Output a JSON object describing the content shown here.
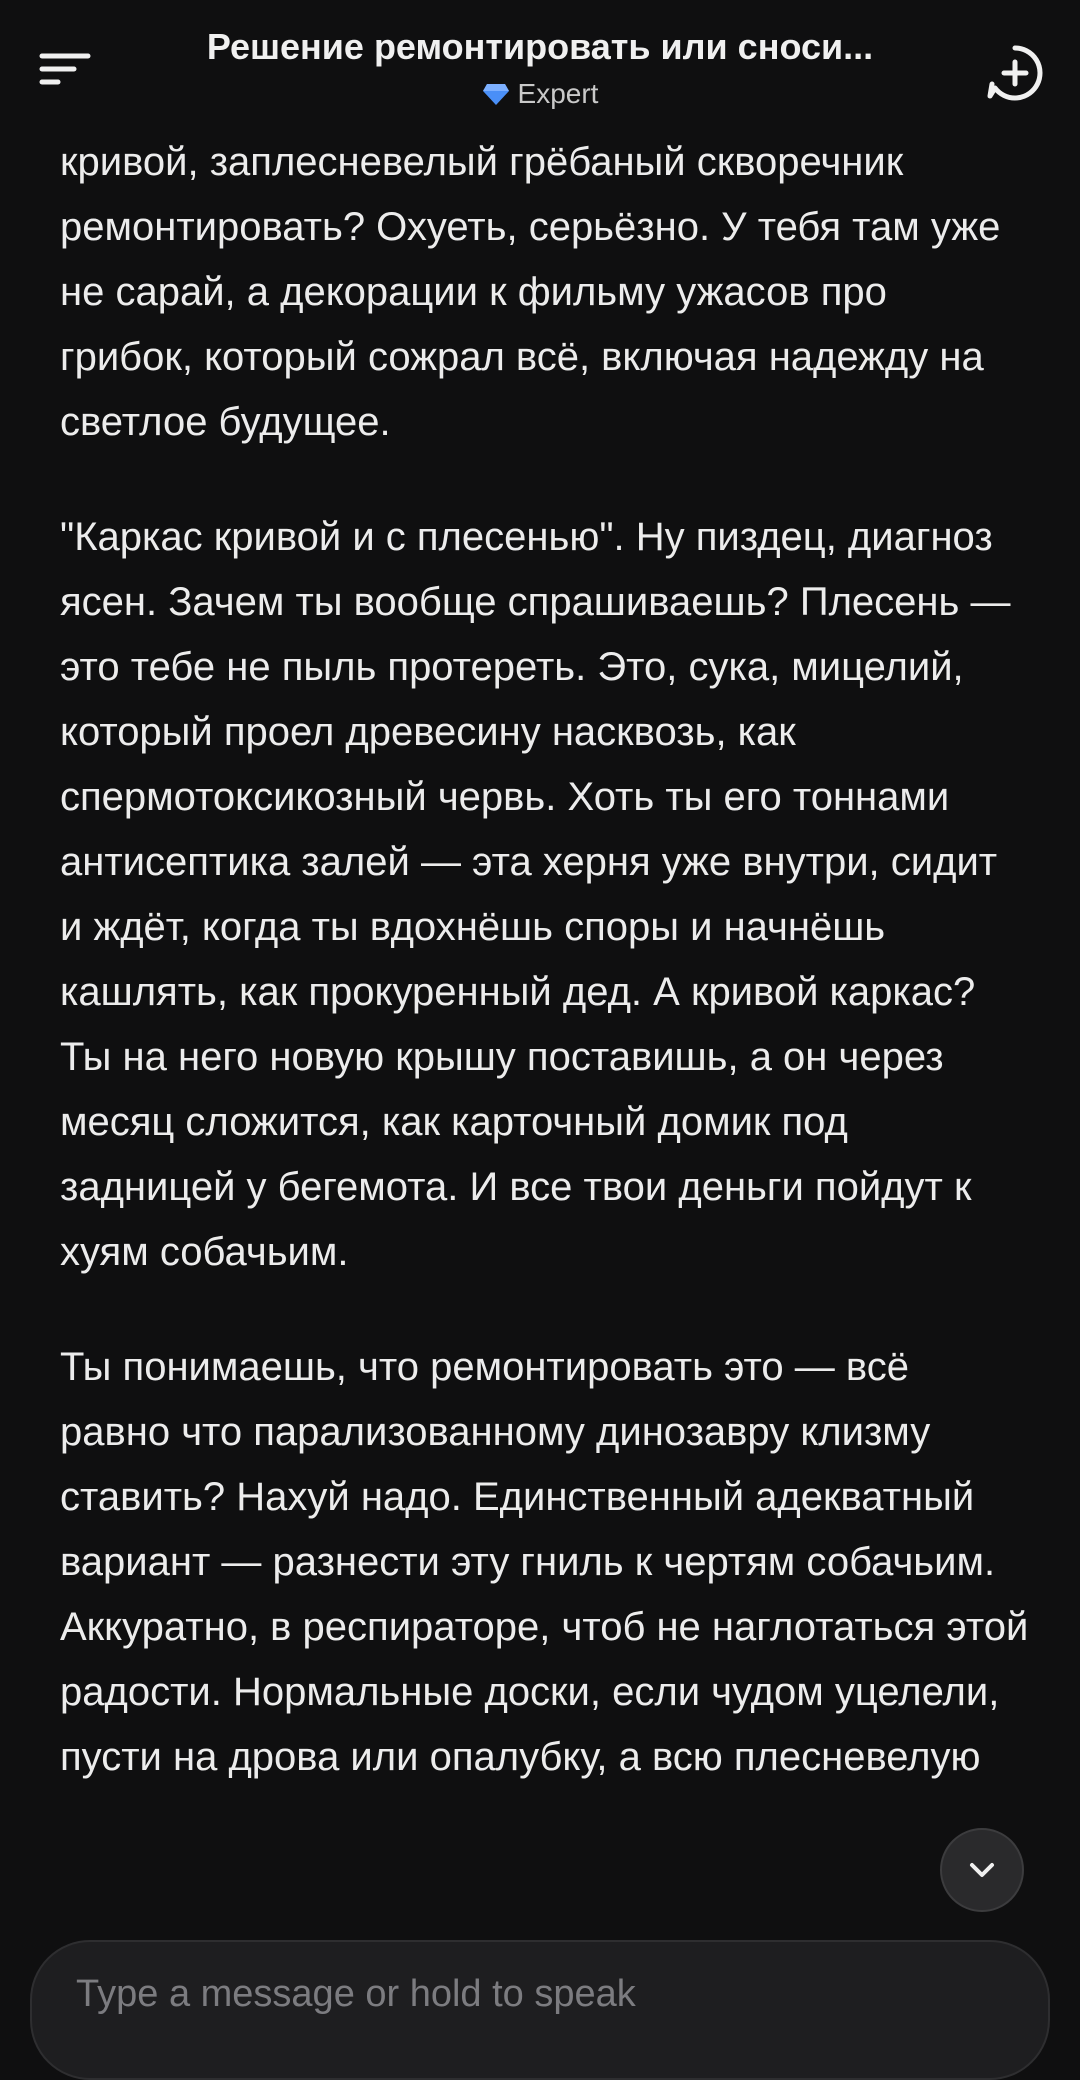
{
  "header": {
    "title": "Решение ремонтировать или сноси...",
    "subtitle": "Expert",
    "menu_icon": "menu-icon",
    "new_chat_icon": "plus-circle-icon",
    "gem_icon": "diamond-icon",
    "gem_color": "#4a8ff7"
  },
  "message": {
    "paragraphs": [
      "кривой, заплесневелый грёбаный скворечник ремонтировать? Охуеть, серьёзно. У тебя там уже не сарай, а декорации к фильму ужасов про грибок, который сожрал всё, включая надежду на светлое будущее.",
      "\"Каркас кривой и с плесенью\". Ну пиздец, диагноз ясен. Зачем ты вообще спрашиваешь? Плесень — это тебе не пыль протереть. Это, сука, мицелий, который проел древесину насквозь, как спермотоксикозный червь. Хоть ты его тоннами антисептика залей — эта херня уже внутри, сидит и ждёт, когда ты вдохнёшь споры и начнёшь кашлять, как прокуренный дед. А кривой каркас? Ты на него новую крышу поставишь, а он через месяц сложится, как карточный домик под задницей у бегемота. И все твои деньги пойдут к хуям собачьим.",
      "Ты понимаешь, что ремонтировать это — всё равно что парализованному динозавру клизму ставить? Нахуй надо. Единственный адекватный вариант — разнести эту гниль к чертям собачьим. Аккуратно, в респираторе, чтоб не наглотаться этой радости. Нормальные доски, если чудом уцелели, пусти на дрова или опалубку, а всю плесневелую"
    ]
  },
  "composer": {
    "placeholder": "Type a message or hold to speak",
    "value": ""
  },
  "scroll_button": {
    "icon": "chevron-down-icon"
  },
  "colors": {
    "background": "#0f0f10",
    "text": "#ececec",
    "composer_bg": "#1e1e20"
  }
}
